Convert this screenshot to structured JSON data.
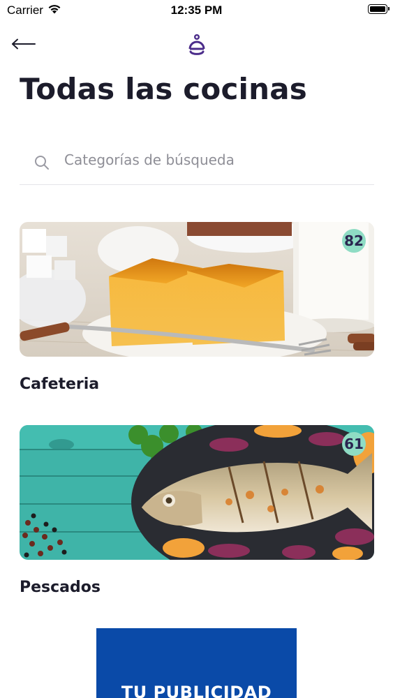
{
  "status_bar": {
    "carrier": "Carrier",
    "time": "12:35 PM",
    "wifi_icon": "wifi-icon",
    "battery_icon": "battery-icon"
  },
  "nav": {
    "back_icon": "arrow-left-icon",
    "logo_icon": "cloche-logo-icon",
    "logo_color": "#4b2c8a"
  },
  "page": {
    "title": "Todas las cocinas"
  },
  "search": {
    "placeholder": "Categorías de búsqueda",
    "value": "",
    "icon": "search-icon"
  },
  "categories": [
    {
      "name": "Cafeteria",
      "count": "82"
    },
    {
      "name": "Pescados",
      "count": "61"
    }
  ],
  "badge_color": "#8fdcc4",
  "ad": {
    "text": "TU PUBLICIDAD",
    "color": "#0a4aa8"
  }
}
